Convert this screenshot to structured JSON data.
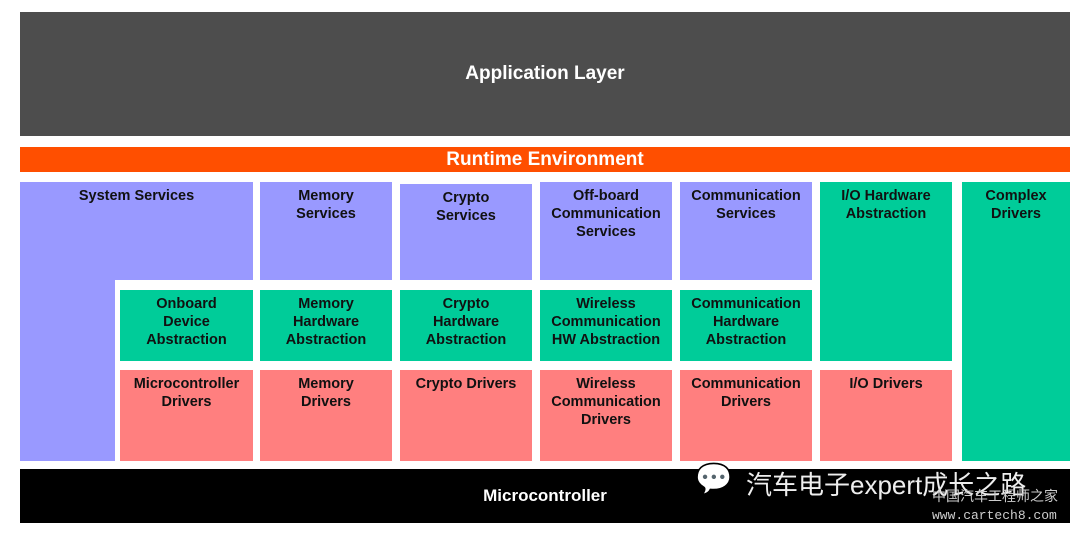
{
  "colors": {
    "application": "#4d4d4d",
    "rte": "#ff4f00",
    "services": "#9999ff",
    "abstraction": "#00cc99",
    "drivers": "#ff7f7f",
    "microcontroller": "#000000"
  },
  "application_layer": "Application Layer",
  "runtime_environment": "Runtime Environment",
  "services": {
    "system": "System Services",
    "memory": "Memory Services",
    "crypto": "Crypto Services",
    "offboard": "Off-board Communication Services",
    "communication": "Communication Services"
  },
  "abstraction": {
    "onboard": "Onboard Device Abstraction",
    "memory": "Memory Hardware Abstraction",
    "crypto": "Crypto Hardware Abstraction",
    "wireless": "Wireless Communication HW Abstraction",
    "communication": "Communication Hardware Abstraction",
    "io": "I/O Hardware Abstraction"
  },
  "drivers": {
    "microcontroller": "Microcontroller Drivers",
    "memory": "Memory Drivers",
    "crypto": "Crypto Drivers",
    "wireless": "Wireless Communication Drivers",
    "communication": "Communication Drivers",
    "io": "I/O Drivers"
  },
  "complex_drivers": "Complex Drivers",
  "microcontroller": "Microcontroller",
  "watermark": {
    "account": "汽车电子expert成长之路",
    "site_cn": "中国汽车工程师之家",
    "site_url": "www.cartech8.com"
  }
}
